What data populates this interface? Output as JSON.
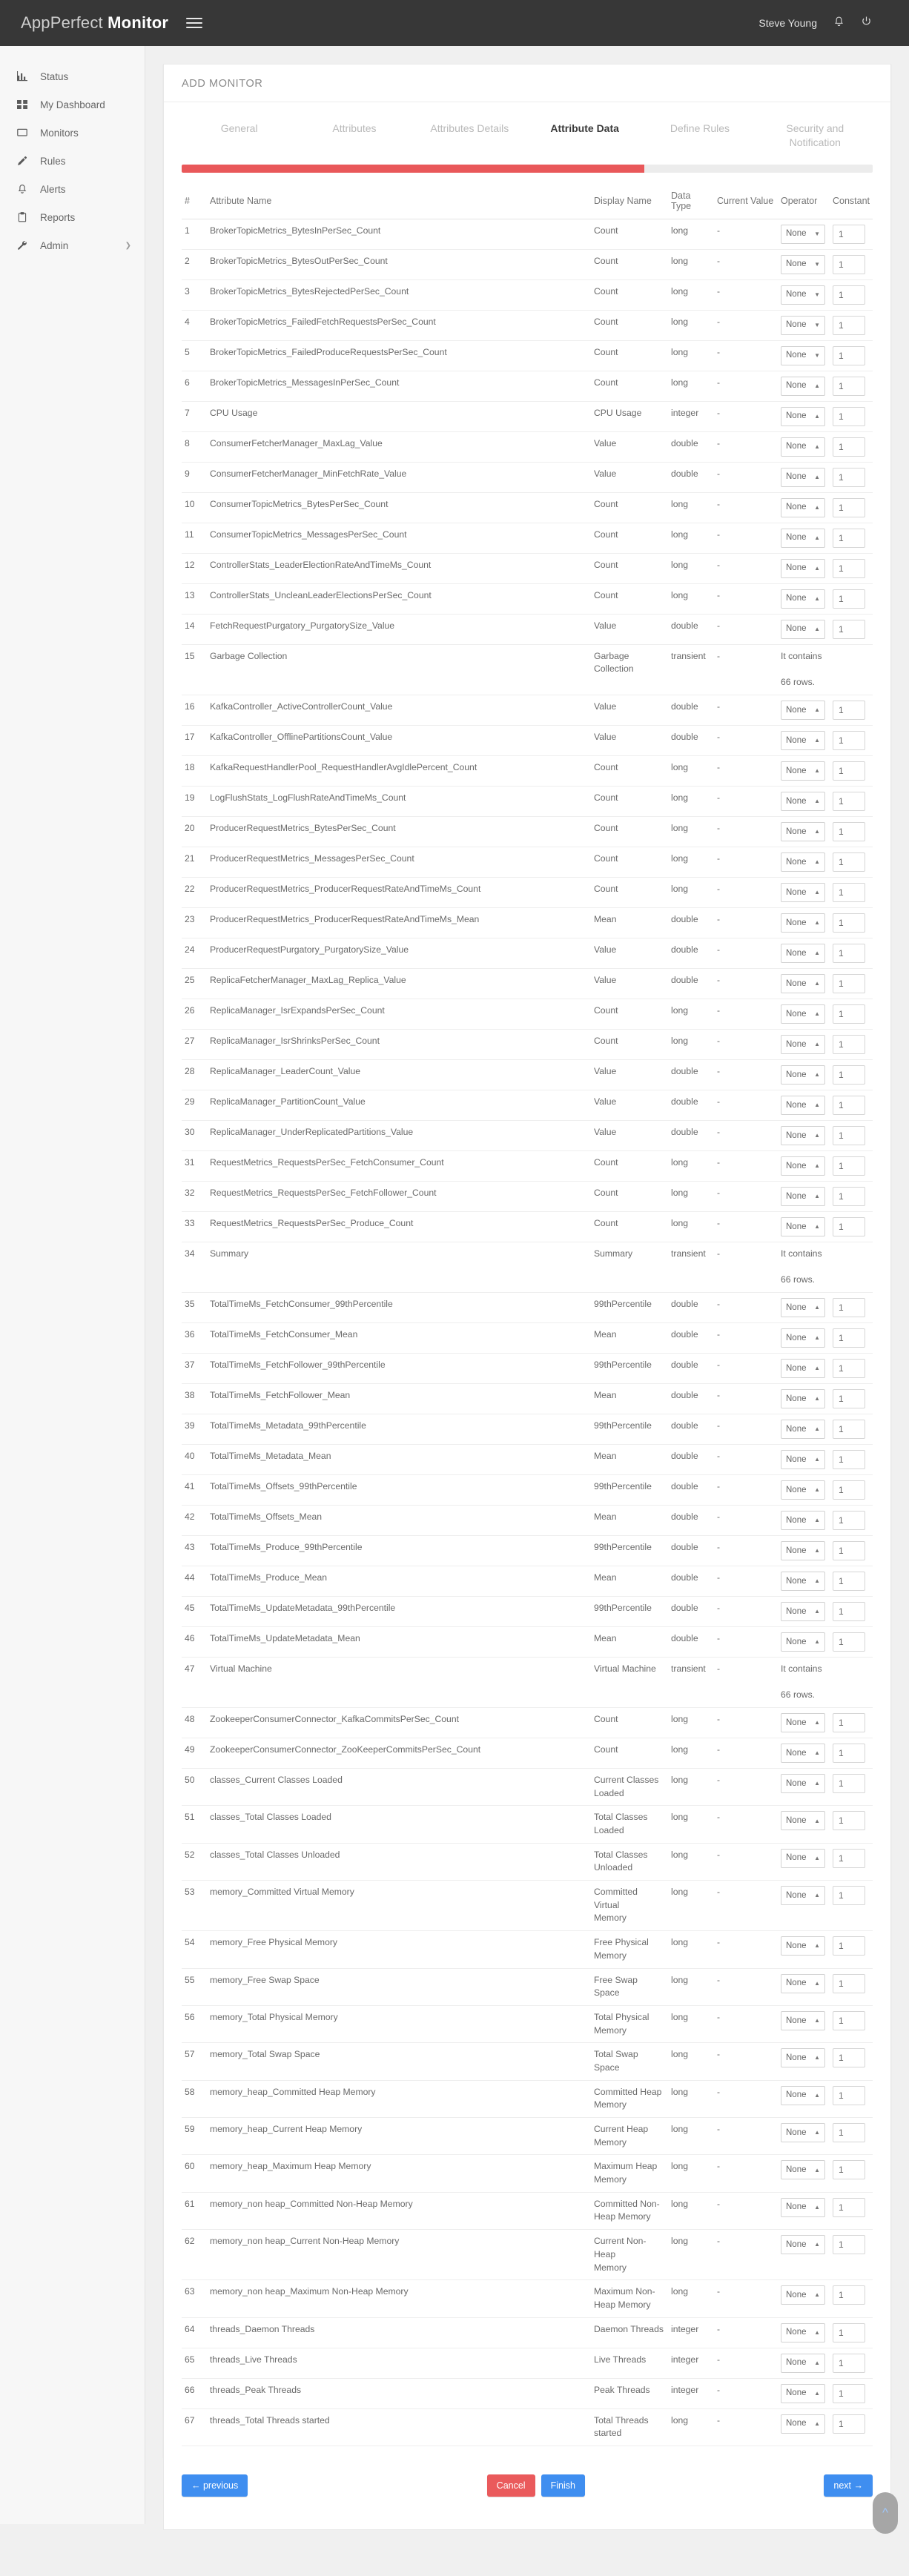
{
  "header": {
    "brand_light": "AppPerfect ",
    "brand_bold": "Monitor",
    "menu_icon": "hamburger-icon",
    "user_name": "Steve Young",
    "bell_icon": "♁",
    "power_icon": "⏻"
  },
  "sidebar": {
    "items": [
      {
        "label": "Status",
        "icon": "bar-chart-icon",
        "caret": ""
      },
      {
        "label": "My Dashboard",
        "icon": "grid-icon",
        "caret": ""
      },
      {
        "label": "Monitors",
        "icon": "monitor-icon",
        "caret": ""
      },
      {
        "label": "Rules",
        "icon": "pencil-icon",
        "caret": ""
      },
      {
        "label": "Alerts",
        "icon": "bell-icon",
        "caret": ""
      },
      {
        "label": "Reports",
        "icon": "clipboard-icon",
        "caret": ""
      },
      {
        "label": "Admin",
        "icon": "wrench-icon",
        "caret": "❯"
      }
    ]
  },
  "card": {
    "title": "ADD MONITOR",
    "tabs": [
      {
        "label": "General",
        "active": false
      },
      {
        "label": "Attributes",
        "active": false
      },
      {
        "label": "Attributes Details",
        "active": false
      },
      {
        "label": "Attribute Data",
        "active": true
      },
      {
        "label": "Define Rules",
        "active": false
      },
      {
        "label": "Security and Notification",
        "active": false
      }
    ],
    "progress_percent": 67,
    "progress_color": "#e9585a"
  },
  "table": {
    "headers": [
      "#",
      "Attribute Name",
      "Display Name",
      "Data Type",
      "Current Value",
      "Operator",
      "Constant"
    ],
    "operator_value": "None",
    "constant_value": "1",
    "contains_text_line1": "It contains",
    "contains_text_line2": "66 rows.",
    "rows": [
      {
        "n": "1",
        "attr": "BrokerTopicMetrics_BytesInPerSec_Count",
        "disp": "Count",
        "type": "long",
        "cur": "-",
        "ctrl": true,
        "arrow": "down"
      },
      {
        "n": "2",
        "attr": "BrokerTopicMetrics_BytesOutPerSec_Count",
        "disp": "Count",
        "type": "long",
        "cur": "-",
        "ctrl": true,
        "arrow": "down"
      },
      {
        "n": "3",
        "attr": "BrokerTopicMetrics_BytesRejectedPerSec_Count",
        "disp": "Count",
        "type": "long",
        "cur": "-",
        "ctrl": true,
        "arrow": "down"
      },
      {
        "n": "4",
        "attr": "BrokerTopicMetrics_FailedFetchRequestsPerSec_Count",
        "disp": "Count",
        "type": "long",
        "cur": "-",
        "ctrl": true,
        "arrow": "down"
      },
      {
        "n": "5",
        "attr": "BrokerTopicMetrics_FailedProduceRequestsPerSec_Count",
        "disp": "Count",
        "type": "long",
        "cur": "-",
        "ctrl": true,
        "arrow": "down"
      },
      {
        "n": "6",
        "attr": "BrokerTopicMetrics_MessagesInPerSec_Count",
        "disp": "Count",
        "type": "long",
        "cur": "-",
        "ctrl": true,
        "arrow": "up"
      },
      {
        "n": "7",
        "attr": "CPU Usage",
        "disp": "CPU Usage",
        "type": "integer",
        "cur": "-",
        "ctrl": true,
        "arrow": "up"
      },
      {
        "n": "8",
        "attr": "ConsumerFetcherManager_MaxLag_Value",
        "disp": "Value",
        "type": "double",
        "cur": "-",
        "ctrl": true,
        "arrow": "up"
      },
      {
        "n": "9",
        "attr": "ConsumerFetcherManager_MinFetchRate_Value",
        "disp": "Value",
        "type": "double",
        "cur": "-",
        "ctrl": true,
        "arrow": "up"
      },
      {
        "n": "10",
        "attr": "ConsumerTopicMetrics_BytesPerSec_Count",
        "disp": "Count",
        "type": "long",
        "cur": "-",
        "ctrl": true,
        "arrow": "up"
      },
      {
        "n": "11",
        "attr": "ConsumerTopicMetrics_MessagesPerSec_Count",
        "disp": "Count",
        "type": "long",
        "cur": "-",
        "ctrl": true,
        "arrow": "up"
      },
      {
        "n": "12",
        "attr": "ControllerStats_LeaderElectionRateAndTimeMs_Count",
        "disp": "Count",
        "type": "long",
        "cur": "-",
        "ctrl": true,
        "arrow": "up"
      },
      {
        "n": "13",
        "attr": "ControllerStats_UncleanLeaderElectionsPerSec_Count",
        "disp": "Count",
        "type": "long",
        "cur": "-",
        "ctrl": true,
        "arrow": "up"
      },
      {
        "n": "14",
        "attr": "FetchRequestPurgatory_PurgatorySize_Value",
        "disp": "Value",
        "type": "double",
        "cur": "-",
        "ctrl": true,
        "arrow": "up"
      },
      {
        "n": "15",
        "attr": "Garbage Collection",
        "disp": "Garbage\nCollection",
        "type": "transient",
        "cur": "-",
        "ctrl": false,
        "contains": true
      },
      {
        "n": "16",
        "attr": "KafkaController_ActiveControllerCount_Value",
        "disp": "Value",
        "type": "double",
        "cur": "-",
        "ctrl": true,
        "arrow": "up"
      },
      {
        "n": "17",
        "attr": "KafkaController_OfflinePartitionsCount_Value",
        "disp": "Value",
        "type": "double",
        "cur": "-",
        "ctrl": true,
        "arrow": "up"
      },
      {
        "n": "18",
        "attr": "KafkaRequestHandlerPool_RequestHandlerAvgIdlePercent_Count",
        "disp": "Count",
        "type": "long",
        "cur": "-",
        "ctrl": true,
        "arrow": "up"
      },
      {
        "n": "19",
        "attr": "LogFlushStats_LogFlushRateAndTimeMs_Count",
        "disp": "Count",
        "type": "long",
        "cur": "-",
        "ctrl": true,
        "arrow": "up"
      },
      {
        "n": "20",
        "attr": "ProducerRequestMetrics_BytesPerSec_Count",
        "disp": "Count",
        "type": "long",
        "cur": "-",
        "ctrl": true,
        "arrow": "up"
      },
      {
        "n": "21",
        "attr": "ProducerRequestMetrics_MessagesPerSec_Count",
        "disp": "Count",
        "type": "long",
        "cur": "-",
        "ctrl": true,
        "arrow": "up"
      },
      {
        "n": "22",
        "attr": "ProducerRequestMetrics_ProducerRequestRateAndTimeMs_Count",
        "disp": "Count",
        "type": "long",
        "cur": "-",
        "ctrl": true,
        "arrow": "up"
      },
      {
        "n": "23",
        "attr": "ProducerRequestMetrics_ProducerRequestRateAndTimeMs_Mean",
        "disp": "Mean",
        "type": "double",
        "cur": "-",
        "ctrl": true,
        "arrow": "up"
      },
      {
        "n": "24",
        "attr": "ProducerRequestPurgatory_PurgatorySize_Value",
        "disp": "Value",
        "type": "double",
        "cur": "-",
        "ctrl": true,
        "arrow": "up"
      },
      {
        "n": "25",
        "attr": "ReplicaFetcherManager_MaxLag_Replica_Value",
        "disp": "Value",
        "type": "double",
        "cur": "-",
        "ctrl": true,
        "arrow": "up"
      },
      {
        "n": "26",
        "attr": "ReplicaManager_IsrExpandsPerSec_Count",
        "disp": "Count",
        "type": "long",
        "cur": "-",
        "ctrl": true,
        "arrow": "up"
      },
      {
        "n": "27",
        "attr": "ReplicaManager_IsrShrinksPerSec_Count",
        "disp": "Count",
        "type": "long",
        "cur": "-",
        "ctrl": true,
        "arrow": "up"
      },
      {
        "n": "28",
        "attr": "ReplicaManager_LeaderCount_Value",
        "disp": "Value",
        "type": "double",
        "cur": "-",
        "ctrl": true,
        "arrow": "up"
      },
      {
        "n": "29",
        "attr": "ReplicaManager_PartitionCount_Value",
        "disp": "Value",
        "type": "double",
        "cur": "-",
        "ctrl": true,
        "arrow": "up"
      },
      {
        "n": "30",
        "attr": "ReplicaManager_UnderReplicatedPartitions_Value",
        "disp": "Value",
        "type": "double",
        "cur": "-",
        "ctrl": true,
        "arrow": "up"
      },
      {
        "n": "31",
        "attr": "RequestMetrics_RequestsPerSec_FetchConsumer_Count",
        "disp": "Count",
        "type": "long",
        "cur": "-",
        "ctrl": true,
        "arrow": "up"
      },
      {
        "n": "32",
        "attr": "RequestMetrics_RequestsPerSec_FetchFollower_Count",
        "disp": "Count",
        "type": "long",
        "cur": "-",
        "ctrl": true,
        "arrow": "up"
      },
      {
        "n": "33",
        "attr": "RequestMetrics_RequestsPerSec_Produce_Count",
        "disp": "Count",
        "type": "long",
        "cur": "-",
        "ctrl": true,
        "arrow": "up"
      },
      {
        "n": "34",
        "attr": "Summary",
        "disp": "Summary",
        "type": "transient",
        "cur": "-",
        "ctrl": false,
        "contains": true
      },
      {
        "n": "35",
        "attr": "TotalTimeMs_FetchConsumer_99thPercentile",
        "disp": "99thPercentile",
        "type": "double",
        "cur": "-",
        "ctrl": true,
        "arrow": "up"
      },
      {
        "n": "36",
        "attr": "TotalTimeMs_FetchConsumer_Mean",
        "disp": "Mean",
        "type": "double",
        "cur": "-",
        "ctrl": true,
        "arrow": "up"
      },
      {
        "n": "37",
        "attr": "TotalTimeMs_FetchFollower_99thPercentile",
        "disp": "99thPercentile",
        "type": "double",
        "cur": "-",
        "ctrl": true,
        "arrow": "up"
      },
      {
        "n": "38",
        "attr": "TotalTimeMs_FetchFollower_Mean",
        "disp": "Mean",
        "type": "double",
        "cur": "-",
        "ctrl": true,
        "arrow": "up"
      },
      {
        "n": "39",
        "attr": "TotalTimeMs_Metadata_99thPercentile",
        "disp": "99thPercentile",
        "type": "double",
        "cur": "-",
        "ctrl": true,
        "arrow": "up"
      },
      {
        "n": "40",
        "attr": "TotalTimeMs_Metadata_Mean",
        "disp": "Mean",
        "type": "double",
        "cur": "-",
        "ctrl": true,
        "arrow": "up"
      },
      {
        "n": "41",
        "attr": "TotalTimeMs_Offsets_99thPercentile",
        "disp": "99thPercentile",
        "type": "double",
        "cur": "-",
        "ctrl": true,
        "arrow": "up"
      },
      {
        "n": "42",
        "attr": "TotalTimeMs_Offsets_Mean",
        "disp": "Mean",
        "type": "double",
        "cur": "-",
        "ctrl": true,
        "arrow": "up"
      },
      {
        "n": "43",
        "attr": "TotalTimeMs_Produce_99thPercentile",
        "disp": "99thPercentile",
        "type": "double",
        "cur": "-",
        "ctrl": true,
        "arrow": "up"
      },
      {
        "n": "44",
        "attr": "TotalTimeMs_Produce_Mean",
        "disp": "Mean",
        "type": "double",
        "cur": "-",
        "ctrl": true,
        "arrow": "up"
      },
      {
        "n": "45",
        "attr": "TotalTimeMs_UpdateMetadata_99thPercentile",
        "disp": "99thPercentile",
        "type": "double",
        "cur": "-",
        "ctrl": true,
        "arrow": "up"
      },
      {
        "n": "46",
        "attr": "TotalTimeMs_UpdateMetadata_Mean",
        "disp": "Mean",
        "type": "double",
        "cur": "-",
        "ctrl": true,
        "arrow": "up"
      },
      {
        "n": "47",
        "attr": "Virtual Machine",
        "disp": "Virtual Machine",
        "type": "transient",
        "cur": "-",
        "ctrl": false,
        "contains": true
      },
      {
        "n": "48",
        "attr": "ZookeeperConsumerConnector_KafkaCommitsPerSec_Count",
        "disp": "Count",
        "type": "long",
        "cur": "-",
        "ctrl": true,
        "arrow": "up"
      },
      {
        "n": "49",
        "attr": "ZookeeperConsumerConnector_ZooKeeperCommitsPerSec_Count",
        "disp": "Count",
        "type": "long",
        "cur": "-",
        "ctrl": true,
        "arrow": "up"
      },
      {
        "n": "50",
        "attr": "classes_Current Classes Loaded",
        "disp": "Current Classes\nLoaded",
        "type": "long",
        "cur": "-",
        "ctrl": true,
        "arrow": "up"
      },
      {
        "n": "51",
        "attr": "classes_Total Classes Loaded",
        "disp": "Total Classes\nLoaded",
        "type": "long",
        "cur": "-",
        "ctrl": true,
        "arrow": "up"
      },
      {
        "n": "52",
        "attr": "classes_Total Classes Unloaded",
        "disp": "Total Classes\nUnloaded",
        "type": "long",
        "cur": "-",
        "ctrl": true,
        "arrow": "up"
      },
      {
        "n": "53",
        "attr": "memory_Committed Virtual Memory",
        "disp": "Committed Virtual\nMemory",
        "type": "long",
        "cur": "-",
        "ctrl": true,
        "arrow": "up"
      },
      {
        "n": "54",
        "attr": "memory_Free Physical Memory",
        "disp": "Free Physical\nMemory",
        "type": "long",
        "cur": "-",
        "ctrl": true,
        "arrow": "up"
      },
      {
        "n": "55",
        "attr": "memory_Free Swap Space",
        "disp": "Free Swap Space",
        "type": "long",
        "cur": "-",
        "ctrl": true,
        "arrow": "up"
      },
      {
        "n": "56",
        "attr": "memory_Total Physical Memory",
        "disp": "Total Physical\nMemory",
        "type": "long",
        "cur": "-",
        "ctrl": true,
        "arrow": "up"
      },
      {
        "n": "57",
        "attr": "memory_Total Swap Space",
        "disp": "Total Swap Space",
        "type": "long",
        "cur": "-",
        "ctrl": true,
        "arrow": "up"
      },
      {
        "n": "58",
        "attr": "memory_heap_Committed Heap Memory",
        "disp": "Committed Heap\nMemory",
        "type": "long",
        "cur": "-",
        "ctrl": true,
        "arrow": "up"
      },
      {
        "n": "59",
        "attr": "memory_heap_Current Heap Memory",
        "disp": "Current Heap\nMemory",
        "type": "long",
        "cur": "-",
        "ctrl": true,
        "arrow": "up"
      },
      {
        "n": "60",
        "attr": "memory_heap_Maximum Heap Memory",
        "disp": "Maximum Heap\nMemory",
        "type": "long",
        "cur": "-",
        "ctrl": true,
        "arrow": "up"
      },
      {
        "n": "61",
        "attr": "memory_non heap_Committed Non-Heap Memory",
        "disp": "Committed Non-\nHeap Memory",
        "type": "long",
        "cur": "-",
        "ctrl": true,
        "arrow": "up"
      },
      {
        "n": "62",
        "attr": "memory_non heap_Current Non-Heap Memory",
        "disp": "Current Non-Heap\nMemory",
        "type": "long",
        "cur": "-",
        "ctrl": true,
        "arrow": "up"
      },
      {
        "n": "63",
        "attr": "memory_non heap_Maximum Non-Heap Memory",
        "disp": "Maximum Non-\nHeap Memory",
        "type": "long",
        "cur": "-",
        "ctrl": true,
        "arrow": "up"
      },
      {
        "n": "64",
        "attr": "threads_Daemon Threads",
        "disp": "Daemon Threads",
        "type": "integer",
        "cur": "-",
        "ctrl": true,
        "arrow": "up"
      },
      {
        "n": "65",
        "attr": "threads_Live Threads",
        "disp": "Live Threads",
        "type": "integer",
        "cur": "-",
        "ctrl": true,
        "arrow": "up"
      },
      {
        "n": "66",
        "attr": "threads_Peak Threads",
        "disp": "Peak Threads",
        "type": "integer",
        "cur": "-",
        "ctrl": true,
        "arrow": "up"
      },
      {
        "n": "67",
        "attr": "threads_Total Threads started",
        "disp": "Total Threads\nstarted",
        "type": "long",
        "cur": "-",
        "ctrl": true,
        "arrow": "up"
      }
    ]
  },
  "footer": {
    "previous_label": "← previous",
    "cancel_label": "Cancel",
    "finish_label": "Finish",
    "next_label": "next →",
    "scroll_top_icon": "chevron-up-icon"
  }
}
